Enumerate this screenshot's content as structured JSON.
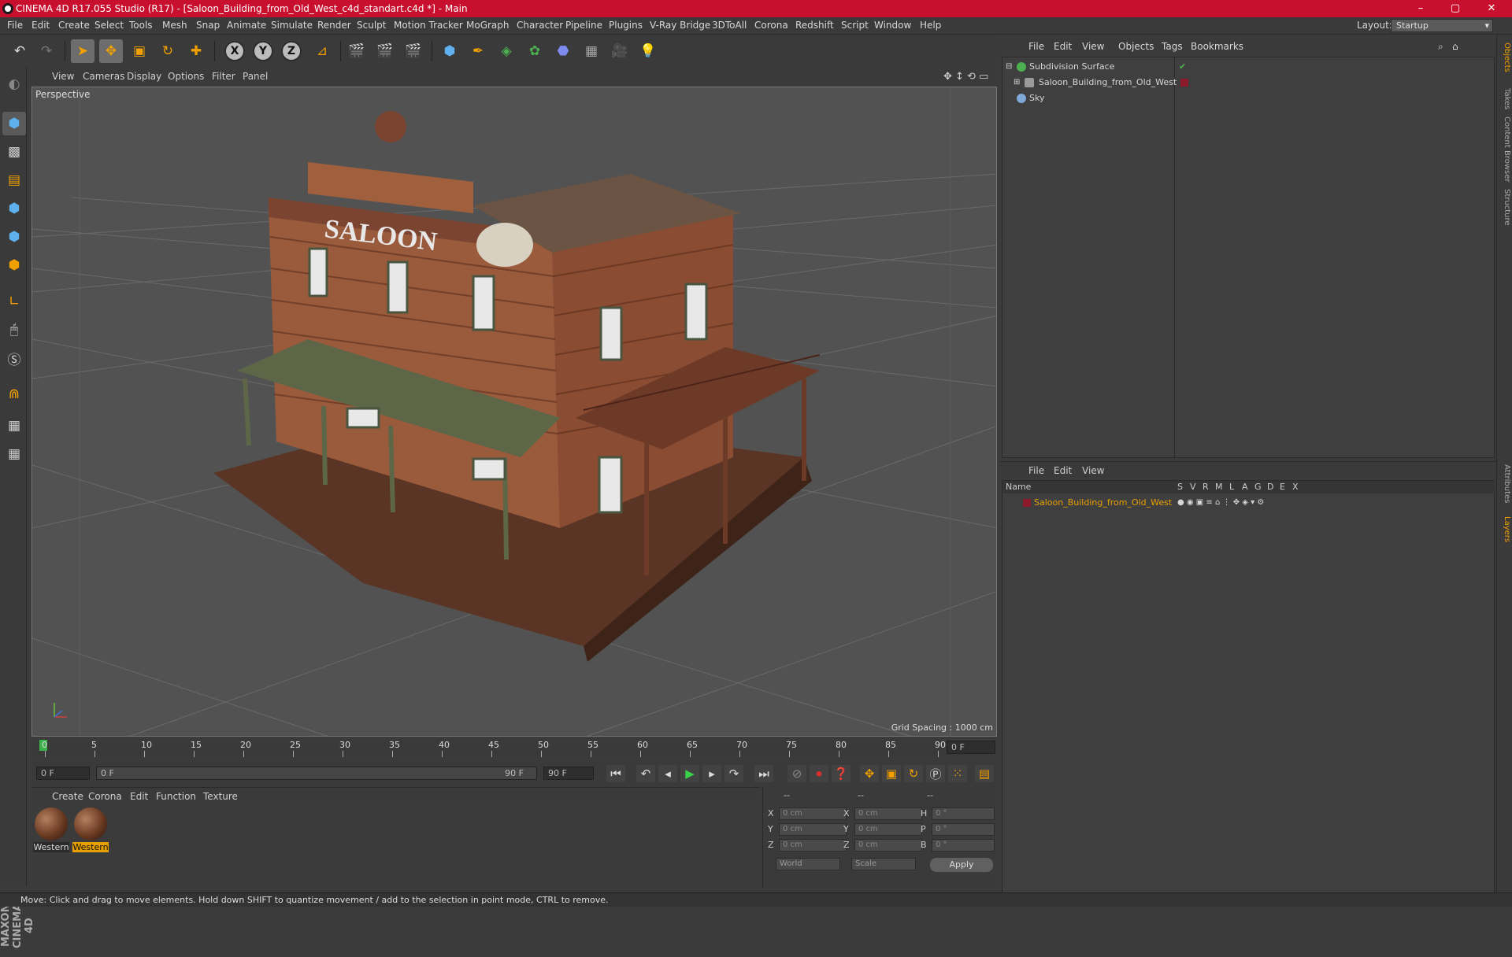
{
  "window": {
    "title": "CINEMA 4D R17.055 Studio (R17) - [Saloon_Building_from_Old_West_c4d_standart.c4d *] - Main",
    "controls": [
      "–",
      "▢",
      "✕"
    ]
  },
  "menu": [
    "File",
    "Edit",
    "Create",
    "Select",
    "Tools",
    "Mesh",
    "Snap",
    "Animate",
    "Simulate",
    "Render",
    "Sculpt",
    "Motion Tracker",
    "MoGraph",
    "Character",
    "Pipeline",
    "Plugins",
    "V-Ray Bridge",
    "3DToAll",
    "Corona",
    "Redshift",
    "Script",
    "Window",
    "Help"
  ],
  "layout": {
    "label": "Layout:",
    "value": "Startup"
  },
  "toolbar": {
    "x": "X",
    "y": "Y",
    "z": "Z"
  },
  "viewport": {
    "menu": [
      "View",
      "Cameras",
      "Display",
      "Options",
      "Filter",
      "Panel"
    ],
    "camera": "Perspective",
    "grid_spacing": "Grid Spacing : 1000 cm",
    "sign_text": "SALOON"
  },
  "timeline": {
    "ticks": [
      "0",
      "5",
      "10",
      "15",
      "20",
      "25",
      "30",
      "35",
      "40",
      "45",
      "50",
      "55",
      "60",
      "65",
      "70",
      "75",
      "80",
      "85",
      "90"
    ],
    "current_frame": "0 F",
    "start_frame": "0 F",
    "range_start": "0 F",
    "range_end": "90 F",
    "end_frame": "90 F"
  },
  "materials": {
    "menu": [
      "Create",
      "Corona",
      "Edit",
      "Function",
      "Texture"
    ],
    "items": [
      {
        "label": "Western",
        "selected": false
      },
      {
        "label": "Western",
        "selected": true
      }
    ]
  },
  "coords": {
    "headers": [
      "--",
      "--",
      "--"
    ],
    "rows": [
      {
        "a": "X",
        "av": "0 cm",
        "b": "X",
        "bv": "0 cm",
        "c": "H",
        "cv": "0 °"
      },
      {
        "a": "Y",
        "av": "0 cm",
        "b": "Y",
        "bv": "0 cm",
        "c": "P",
        "cv": "0 °"
      },
      {
        "a": "Z",
        "av": "0 cm",
        "b": "Z",
        "bv": "0 cm",
        "c": "B",
        "cv": "0 °"
      }
    ],
    "world": "World",
    "scale": "Scale",
    "apply": "Apply"
  },
  "objects": {
    "menu": [
      "File",
      "Edit",
      "View",
      "Objects",
      "Tags",
      "Bookmarks"
    ],
    "items": [
      {
        "name": "Subdivision Surface",
        "color": "#4caf50"
      },
      {
        "name": "Saloon_Building_from_Old_West",
        "color": "#9a9a9a"
      },
      {
        "name": "Sky",
        "color": "#7ea8d8"
      }
    ]
  },
  "layers": {
    "menu": [
      "File",
      "Edit",
      "View"
    ],
    "columns": [
      "Name",
      "S",
      "V",
      "R",
      "M",
      "L",
      "A",
      "G",
      "D",
      "E",
      "X"
    ],
    "items": [
      {
        "name": "Saloon_Building_from_Old_West",
        "color": "#e8a000"
      }
    ]
  },
  "side_tabs": [
    "Objects",
    "Takes",
    "Content Browser",
    "Structure",
    "Attributes",
    "Layers"
  ],
  "brand": "MAXON CINEMA 4D",
  "status": "Move: Click and drag to move elements. Hold down SHIFT to quantize movement / add to the selection in point mode, CTRL to remove."
}
